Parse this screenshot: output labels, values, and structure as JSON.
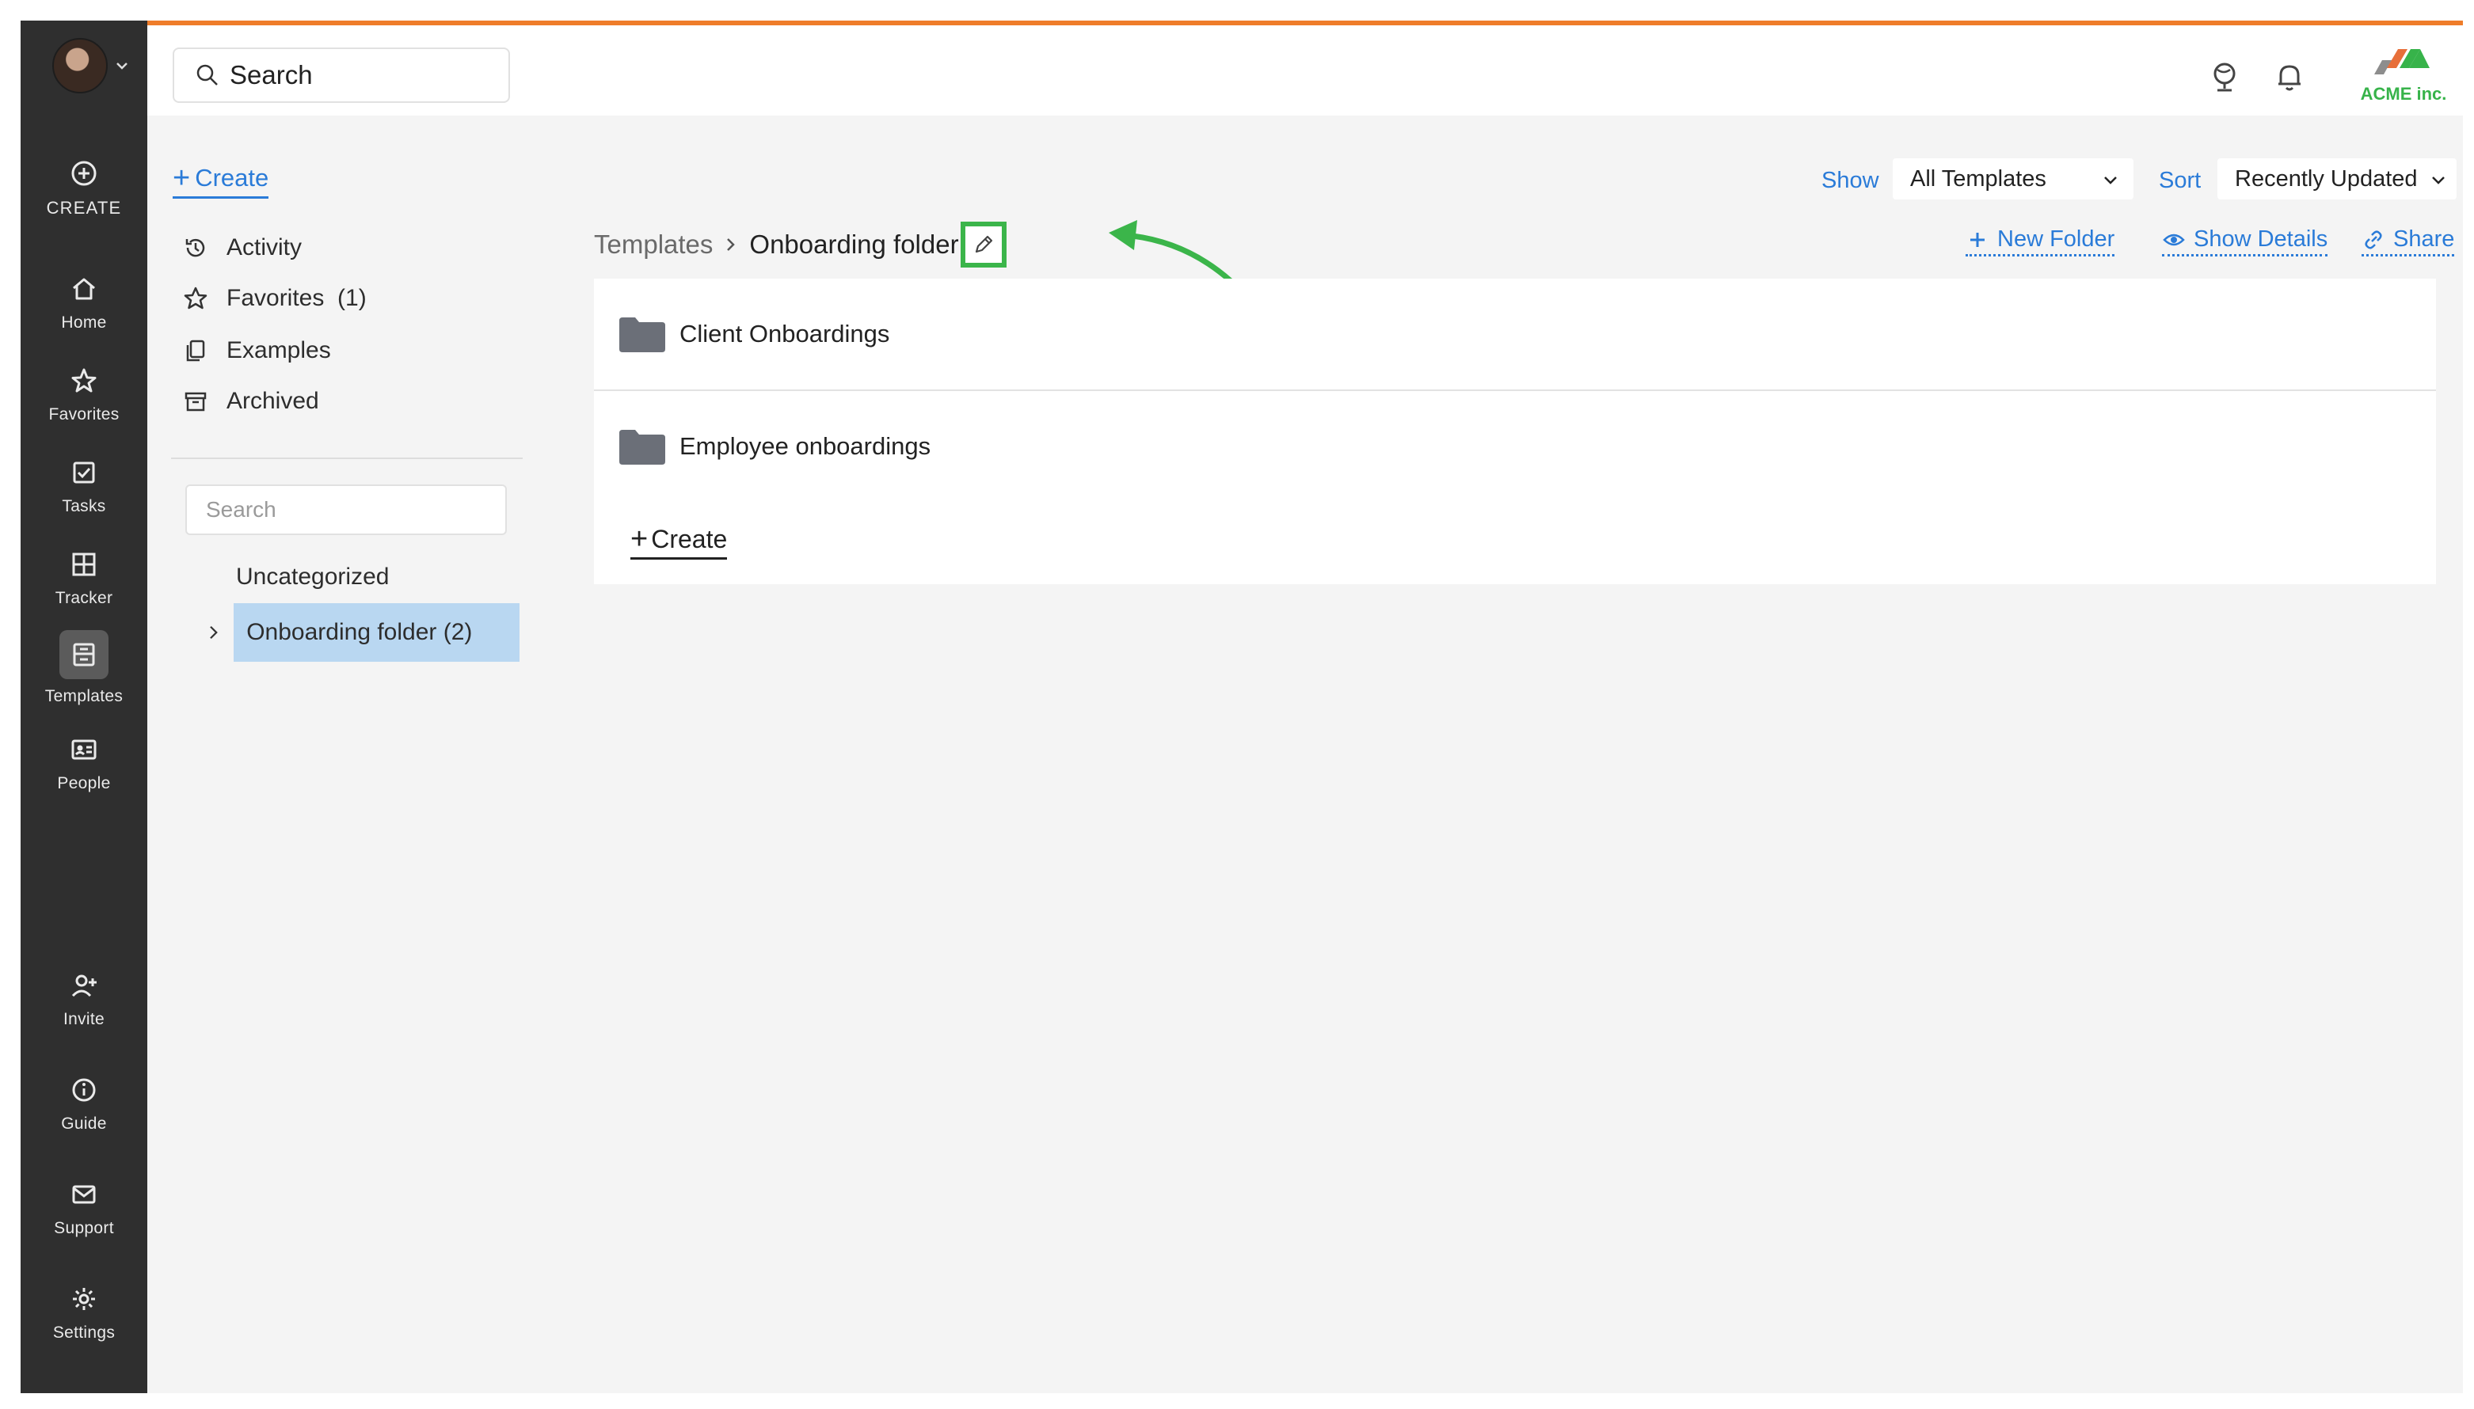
{
  "rail": {
    "create": "CREATE",
    "items": [
      {
        "label": "Home",
        "icon": "home-icon"
      },
      {
        "label": "Favorites",
        "icon": "star-icon"
      },
      {
        "label": "Tasks",
        "icon": "checkbox-icon"
      },
      {
        "label": "Tracker",
        "icon": "grid-icon"
      },
      {
        "label": "Templates",
        "icon": "templates-icon"
      },
      {
        "label": "People",
        "icon": "id-card-icon"
      }
    ],
    "bottom": [
      {
        "label": "Invite",
        "icon": "add-user-icon"
      },
      {
        "label": "Guide",
        "icon": "info-icon"
      },
      {
        "label": "Support",
        "icon": "mail-icon"
      },
      {
        "label": "Settings",
        "icon": "gear-icon"
      }
    ]
  },
  "topbar": {
    "search_placeholder": "Search",
    "logo_text": "ACME inc.",
    "accent_color": "#ef7d2a"
  },
  "sidebar": {
    "create_label": "Create",
    "nav": [
      {
        "label": "Activity",
        "icon": "history-icon"
      },
      {
        "label": "Favorites  (1)",
        "icon": "star-icon"
      },
      {
        "label": "Examples",
        "icon": "copy-icon"
      },
      {
        "label": "Archived",
        "icon": "archive-icon"
      }
    ],
    "search_placeholder": "Search",
    "folders": [
      {
        "label": "Uncategorized"
      },
      {
        "label": "Onboarding folder (2)"
      }
    ]
  },
  "main": {
    "show_label": "Show",
    "show_value": "All Templates",
    "sort_label": "Sort",
    "sort_value": "Recently Updated",
    "breadcrumb_root": "Templates",
    "breadcrumb_current": "Onboarding folder",
    "actions": {
      "new_folder": "New Folder",
      "show_details": "Show Details",
      "share": "Share"
    },
    "folders": [
      {
        "label": "Client Onboardings"
      },
      {
        "label": "Employee onboardings"
      }
    ],
    "create_label": "Create",
    "highlight_color": "#3bb54a"
  }
}
